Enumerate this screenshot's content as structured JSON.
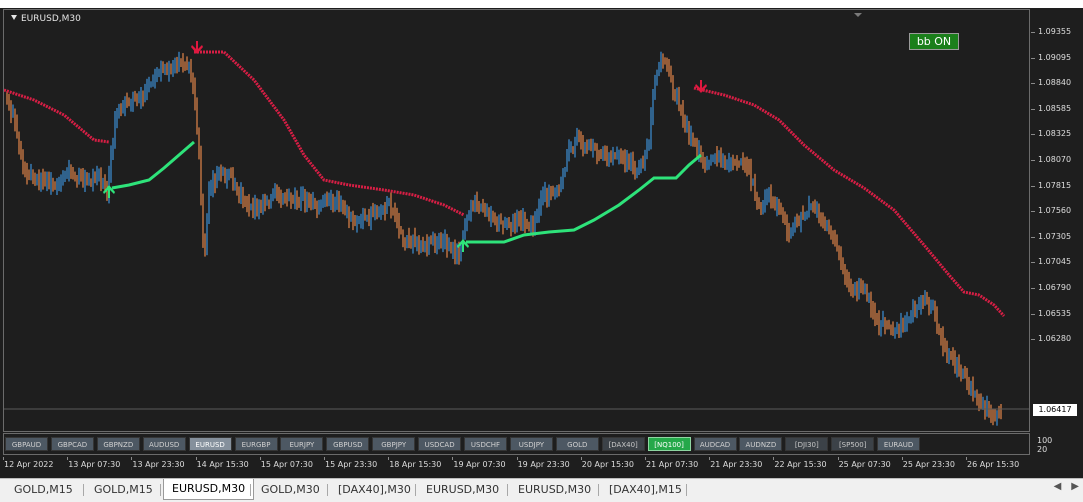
{
  "chart": {
    "title": "EURUSD,M30",
    "indicator_button": "bb ON",
    "colors": {
      "background": "#1e1e1e",
      "bull_candle": "#3d8fd6",
      "bear_candle": "#e2854a",
      "upper_band": "#d81e45",
      "lower_band": "#2ee37a",
      "sell_arrow": "#e0183f",
      "buy_arrow": "#2ee37a"
    },
    "current_price": "1.06417",
    "y_axis_labels": [
      "1.09355",
      "1.09095",
      "1.08840",
      "1.08585",
      "1.08325",
      "1.08070",
      "1.07815",
      "1.07560",
      "1.07305",
      "1.07045",
      "1.06790",
      "1.06535",
      "1.06280"
    ],
    "x_axis_labels": [
      "12 Apr 2022",
      "13 Apr 07:30",
      "13 Apr 23:30",
      "14 Apr 15:30",
      "15 Apr 07:30",
      "15 Apr 23:30",
      "18 Apr 15:30",
      "19 Apr 07:30",
      "19 Apr 23:30",
      "20 Apr 15:30",
      "21 Apr 07:30",
      "21 Apr 23:30",
      "22 Apr 15:30",
      "25 Apr 07:30",
      "25 Apr 23:30",
      "26 Apr 15:30"
    ],
    "subwindow_labels": [
      "100",
      "20"
    ]
  },
  "symbols": [
    {
      "label": "GBPAUD",
      "state": "normal"
    },
    {
      "label": "GBPCAD",
      "state": "normal"
    },
    {
      "label": "GBPNZD",
      "state": "normal"
    },
    {
      "label": "AUDUSD",
      "state": "normal"
    },
    {
      "label": "EURUSD",
      "state": "selected"
    },
    {
      "label": "EURGBP",
      "state": "normal"
    },
    {
      "label": "EURJPY",
      "state": "normal"
    },
    {
      "label": "GBPUSD",
      "state": "normal"
    },
    {
      "label": "GBPJPY",
      "state": "normal"
    },
    {
      "label": "USDCAD",
      "state": "normal"
    },
    {
      "label": "USDCHF",
      "state": "normal"
    },
    {
      "label": "USDJPY",
      "state": "normal"
    },
    {
      "label": "GOLD",
      "state": "normal"
    },
    {
      "label": "[DAX40]",
      "state": "bracket"
    },
    {
      "label": "[NQ100]",
      "state": "active"
    },
    {
      "label": "AUDCAD",
      "state": "normal"
    },
    {
      "label": "AUDNZD",
      "state": "normal"
    },
    {
      "label": "[DJI30]",
      "state": "bracket"
    },
    {
      "label": "[SP500]",
      "state": "bracket"
    },
    {
      "label": "EURAUD",
      "state": "normal"
    }
  ],
  "tabs": [
    {
      "label": "GOLD,M15",
      "active": false
    },
    {
      "label": "GOLD,M15",
      "active": false
    },
    {
      "label": "EURUSD,M30",
      "active": true
    },
    {
      "label": "GOLD,M30",
      "active": false
    },
    {
      "label": "[DAX40],M30",
      "active": false
    },
    {
      "label": "EURUSD,M30",
      "active": false
    },
    {
      "label": "EURUSD,M30",
      "active": false
    },
    {
      "label": "[DAX40],M15",
      "active": false
    }
  ]
}
